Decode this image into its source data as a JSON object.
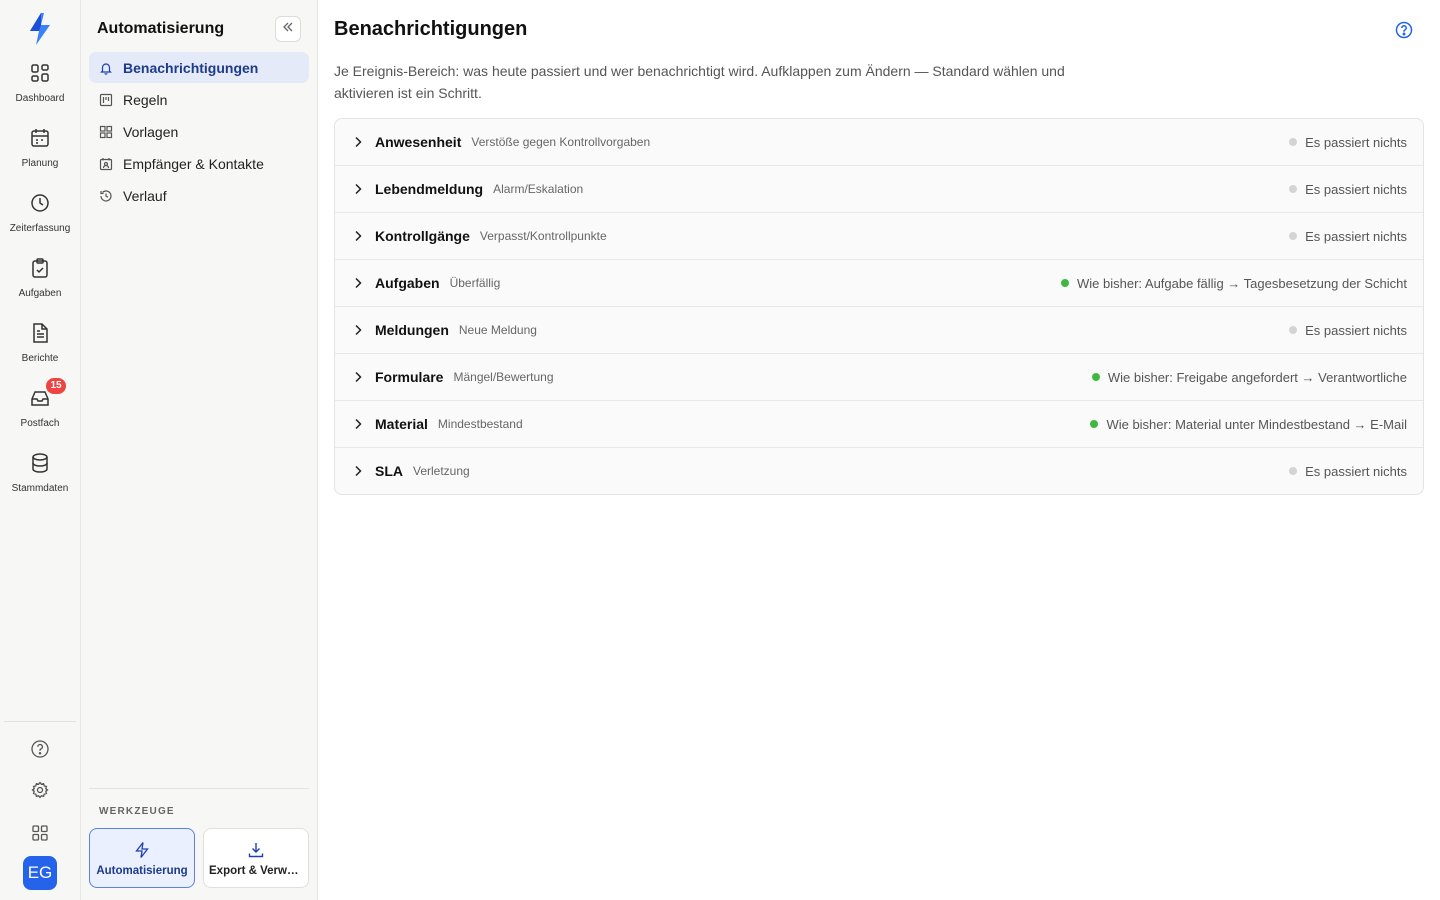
{
  "rail": {
    "items": [
      {
        "label": "Dashboard",
        "icon": "dashboard-icon"
      },
      {
        "label": "Planung",
        "icon": "calendar-icon"
      },
      {
        "label": "Zeiterfassung",
        "icon": "clock-icon"
      },
      {
        "label": "Aufgaben",
        "icon": "clipboard-check-icon"
      },
      {
        "label": "Berichte",
        "icon": "document-icon"
      },
      {
        "label": "Postfach",
        "icon": "inbox-icon",
        "badge": "15"
      },
      {
        "label": "Stammdaten",
        "icon": "database-icon"
      }
    ],
    "avatar": "EG"
  },
  "sidebar": {
    "title": "Automatisierung",
    "items": [
      {
        "label": "Benachrichtigungen",
        "icon": "bell-icon",
        "active": true
      },
      {
        "label": "Regeln",
        "icon": "rules-icon"
      },
      {
        "label": "Vorlagen",
        "icon": "grid-icon"
      },
      {
        "label": "Empfänger & Kontakte",
        "icon": "contacts-icon"
      },
      {
        "label": "Verlauf",
        "icon": "history-icon"
      }
    ],
    "tools_label": "WERKZEUGE",
    "tools": [
      {
        "label": "Automatisierung",
        "icon": "lightning-icon",
        "active": true
      },
      {
        "label": "Export & Verwaltung",
        "icon": "download-icon"
      }
    ]
  },
  "main": {
    "title": "Benachrichtigungen",
    "description": "Je Ereignis-Bereich: was heute passiert und wer benachrichtigt wird. Aufklappen zum Ändern — Standard wählen und aktivieren ist ein Schritt.",
    "rows": [
      {
        "name": "Anwesenheit",
        "sub": "Verstöße gegen Kontrollvorgaben",
        "status": "Es passiert nichts",
        "active": false
      },
      {
        "name": "Lebendmeldung",
        "sub": "Alarm/Eskalation",
        "status": "Es passiert nichts",
        "active": false
      },
      {
        "name": "Kontrollgänge",
        "sub": "Verpasst/Kontrollpunkte",
        "status": "Es passiert nichts",
        "active": false
      },
      {
        "name": "Aufgaben",
        "sub": "Überfällig",
        "status": "Wie bisher: Aufgabe fällig → Tagesbesetzung der Schicht",
        "active": true
      },
      {
        "name": "Meldungen",
        "sub": "Neue Meldung",
        "status": "Es passiert nichts",
        "active": false
      },
      {
        "name": "Formulare",
        "sub": "Mängel/Bewertung",
        "status": "Wie bisher: Freigabe angefordert → Verantwortliche",
        "active": true
      },
      {
        "name": "Material",
        "sub": "Mindestbestand",
        "status": "Wie bisher: Material unter Mindestbestand → E-Mail",
        "active": true
      },
      {
        "name": "SLA",
        "sub": "Verletzung",
        "status": "Es passiert nichts",
        "active": false
      }
    ]
  },
  "colors": {
    "accent": "#2563eb",
    "active_dot": "#3fb83f",
    "inactive_dot": "#d4d4d2",
    "badge": "#ef4444"
  }
}
